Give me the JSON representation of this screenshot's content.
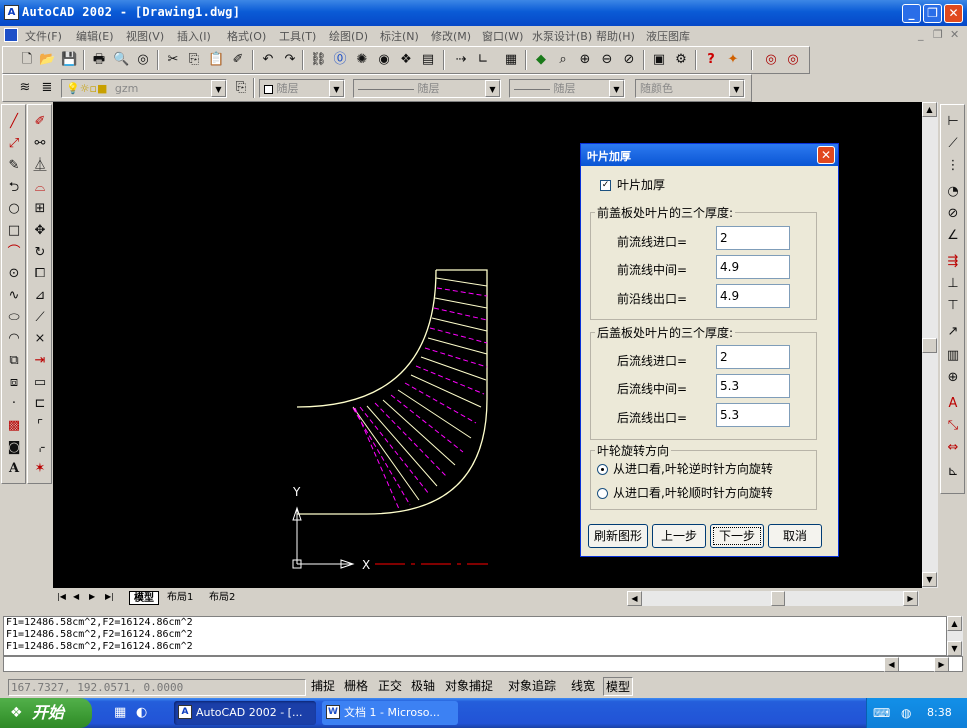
{
  "window": {
    "title": "AutoCAD 2002 - [Drawing1.dwg]",
    "app_icon": "autocad-app-icon",
    "controls": [
      "minimize",
      "restore",
      "close"
    ]
  },
  "menubar": {
    "items": [
      "文件(F)",
      "编辑(E)",
      "视图(V)",
      "插入(I)",
      "格式(O)",
      "工具(T)",
      "绘图(D)",
      "标注(N)",
      "修改(M)",
      "窗口(W)",
      "水泵设计(B)",
      "帮助(H)",
      "液压图库"
    ]
  },
  "layers_toolbar": {
    "layer_name": "gzm",
    "color": "随层",
    "linetype": "随层",
    "lineweight": "随层",
    "plotstyle": "随颜色"
  },
  "layout_tabs": {
    "tabs": [
      "模型",
      "布局1",
      "布局2"
    ],
    "active": "模型"
  },
  "dialog": {
    "title": "叶片加厚",
    "checkbox_label": "叶片加厚",
    "checkbox_checked": true,
    "front_group": {
      "title": "前盖板处叶片的三个厚度:",
      "rows": [
        {
          "label": "前流线进口=",
          "value": "2"
        },
        {
          "label": "前流线中间=",
          "value": "4.9"
        },
        {
          "label": "前沿线出口=",
          "value": "4.9"
        }
      ]
    },
    "back_group": {
      "title": "后盖板处叶片的三个厚度:",
      "rows": [
        {
          "label": "后流线进口=",
          "value": "2"
        },
        {
          "label": "后流线中间=",
          "value": "5.3"
        },
        {
          "label": "后流线出口=",
          "value": "5.3"
        }
      ]
    },
    "rotation_group": {
      "title": "叶轮旋转方向",
      "options": [
        {
          "label": "从进口看,叶轮逆时针方向旋转",
          "selected": true
        },
        {
          "label": "从进口看,叶轮顺时针方向旋转",
          "selected": false
        }
      ]
    },
    "buttons": {
      "refresh": "刷新图形",
      "prev": "上一步",
      "next": "下一步",
      "cancel": "取消"
    }
  },
  "command_history": [
    "F1=12486.58cm^2,F2=16124.86cm^2",
    "F1=12486.58cm^2,F2=16124.86cm^2",
    "F1=12486.58cm^2,F2=16124.86cm^2"
  ],
  "statusbar": {
    "coords": "167.7327, 192.0571, 0.0000",
    "toggles": [
      "捕捉",
      "栅格",
      "正交",
      "极轴",
      "对象捕捉",
      "对象追踪",
      "线宽",
      "模型"
    ]
  },
  "taskbar": {
    "start_label": "开始",
    "tasks": [
      "AutoCAD 2002 - [...",
      "文档 1 - Microso..."
    ],
    "clock": "8:38"
  },
  "ucs": {
    "y_label": "Y",
    "x_label": "X"
  },
  "colors": {
    "canvas": "#000000",
    "geometry": "#ffffcc",
    "blade_line_magenta": "#ff00ff",
    "x_axis_red": "#ff0000",
    "titlebar": "#0a5bd6",
    "face": "#d4d0c8"
  }
}
